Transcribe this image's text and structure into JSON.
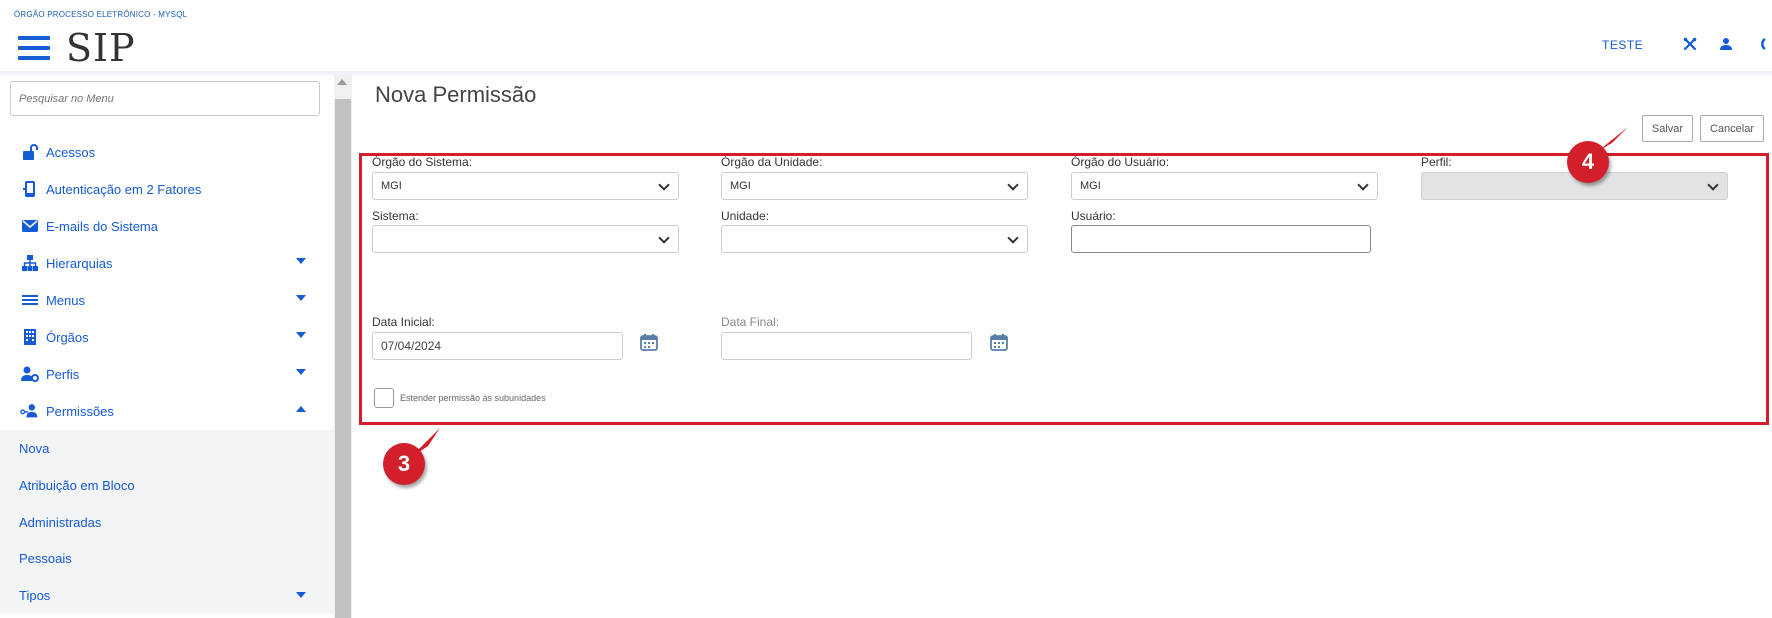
{
  "header": {
    "org_name": "ÓRGÃO PROCESSO ELETRÔNICO - MYSQL",
    "logo": "SIP",
    "user_name": "TESTE",
    "icons": [
      "tools-icon",
      "user-icon",
      "logout-icon"
    ]
  },
  "sidebar": {
    "search_placeholder": "Pesquisar no Menu",
    "items": [
      {
        "label": "Acessos",
        "icon": "unlock-icon",
        "expandable": false
      },
      {
        "label": "Autenticação em 2 Fatores",
        "icon": "mobile-icon",
        "expandable": false
      },
      {
        "label": "E-mails do Sistema",
        "icon": "envelope-icon",
        "expandable": false
      },
      {
        "label": "Hierarquias",
        "icon": "sitemap-icon",
        "expandable": true
      },
      {
        "label": "Menus",
        "icon": "list-icon",
        "expandable": true
      },
      {
        "label": "Órgãos",
        "icon": "building-icon",
        "expandable": true
      },
      {
        "label": "Perfis",
        "icon": "user-gear-icon",
        "expandable": true
      },
      {
        "label": "Permissões",
        "icon": "user-key-icon",
        "expandable": true,
        "expanded": true
      }
    ],
    "sub_items": [
      {
        "label": "Nova"
      },
      {
        "label": "Atribuição em Bloco"
      },
      {
        "label": "Administradas"
      },
      {
        "label": "Pessoais"
      },
      {
        "label": "Tipos",
        "expandable": true
      }
    ]
  },
  "main": {
    "title": "Nova Permissão",
    "save_label": "Salvar",
    "cancel_label": "Cancelar",
    "form": {
      "orgao_sistema_label": "Órgão do Sistema:",
      "orgao_sistema_value": "MGI",
      "orgao_unidade_label": "Órgão da Unidade:",
      "orgao_unidade_value": "MGI",
      "orgao_usuario_label": "Órgão do Usuário:",
      "orgao_usuario_value": "MGI",
      "perfil_label": "Perfil:",
      "perfil_value": "",
      "sistema_label": "Sistema:",
      "sistema_value": "",
      "unidade_label": "Unidade:",
      "unidade_value": "",
      "usuario_label": "Usuário:",
      "usuario_value": "",
      "data_inicial_label": "Data Inicial:",
      "data_inicial_value": "07/04/2024",
      "data_final_label": "Data Final:",
      "data_final_value": "",
      "estender_label": "Estender permissão às subunidades"
    }
  },
  "annotations": {
    "badge_3": "3",
    "badge_4": "4"
  },
  "colors": {
    "accent": "#155bd5",
    "highlight": "#d21f2a"
  }
}
